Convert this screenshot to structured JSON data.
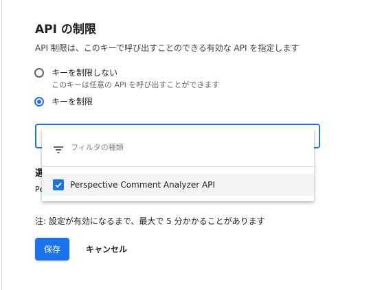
{
  "section": {
    "title": "API の制限",
    "description": "API 制限は、このキーで呼び出すことのできる有効な API を指定します"
  },
  "restriction_options": [
    {
      "label": "キーを制限しない",
      "sublabel": "このキーは任意の API を呼び出すことができます",
      "selected": false
    },
    {
      "label": "キーを制限",
      "selected": true
    }
  ],
  "api_dropdown": {
    "filter_placeholder": "フィルタの種類",
    "filter_icon": "filter-list-icon",
    "options": [
      {
        "label": "Perspective Comment Analyzer API",
        "checked": true
      }
    ]
  },
  "selected_apis": {
    "label_fragment": "選",
    "value_fragment": "Pe"
  },
  "note": "注: 設定が有効になるまで、最大で 5 分かかることがあります",
  "actions": {
    "save_label": "保存",
    "cancel_label": "キャンセル"
  },
  "colors": {
    "accent": "#1a73e8",
    "option_highlight": "#f1f3f4"
  }
}
